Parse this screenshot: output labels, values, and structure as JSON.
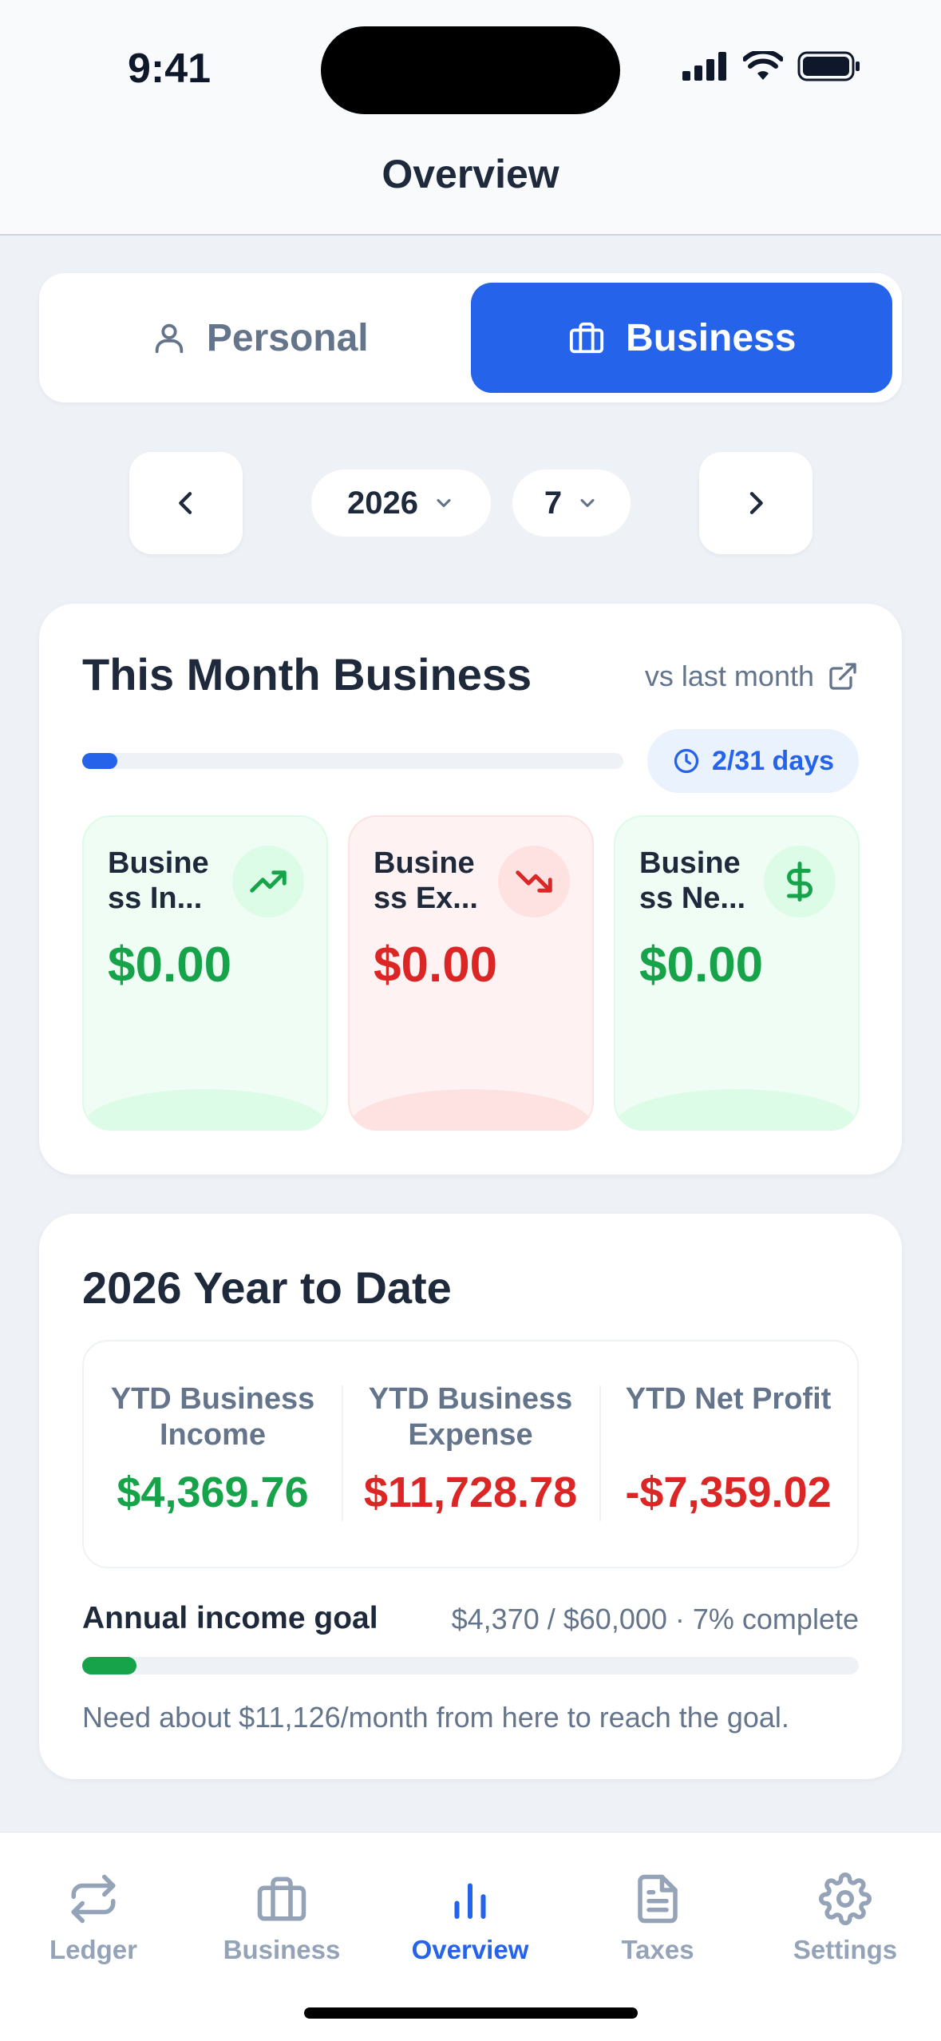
{
  "status": {
    "time": "9:41"
  },
  "header": {
    "title": "Overview"
  },
  "segment": {
    "personal": "Personal",
    "business": "Business",
    "active": "business"
  },
  "period": {
    "year": "2026",
    "month": "7"
  },
  "month_card": {
    "title": "This Month Business",
    "compare_link": "vs last month",
    "days_badge": "2/31 days",
    "days_progress": 0.065,
    "metrics": [
      {
        "label": "Busine ss In...",
        "value": "$0.00",
        "tone": "green",
        "icon": "trending-up-icon"
      },
      {
        "label": "Busine ss Ex...",
        "value": "$0.00",
        "tone": "red",
        "icon": "trending-down-icon"
      },
      {
        "label": "Busine ss Ne...",
        "value": "$0.00",
        "tone": "green",
        "icon": "dollar-icon"
      }
    ]
  },
  "ytd_card": {
    "title": "2026 Year to Date",
    "columns": [
      {
        "label": "YTD Business Income",
        "value": "$4,369.76",
        "color": "#16a34a"
      },
      {
        "label": "YTD Business Expense",
        "value": "$11,728.78",
        "color": "#dc2626"
      },
      {
        "label": "YTD Net Profit",
        "value": "-$7,359.02",
        "color": "#dc2626"
      }
    ],
    "goal_title": "Annual income goal",
    "goal_stats": "$4,370 / $60,000 · 7% complete",
    "goal_progress": 0.07,
    "goal_hint": "Need about $11,126/month from here to reach the goal."
  },
  "tabs": [
    {
      "label": "Ledger",
      "icon": "swap-icon",
      "active": false
    },
    {
      "label": "Business",
      "icon": "briefcase-icon",
      "active": false
    },
    {
      "label": "Overview",
      "icon": "bar-chart-icon",
      "active": true
    },
    {
      "label": "Taxes",
      "icon": "document-icon",
      "active": false
    },
    {
      "label": "Settings",
      "icon": "gear-icon",
      "active": false
    }
  ]
}
